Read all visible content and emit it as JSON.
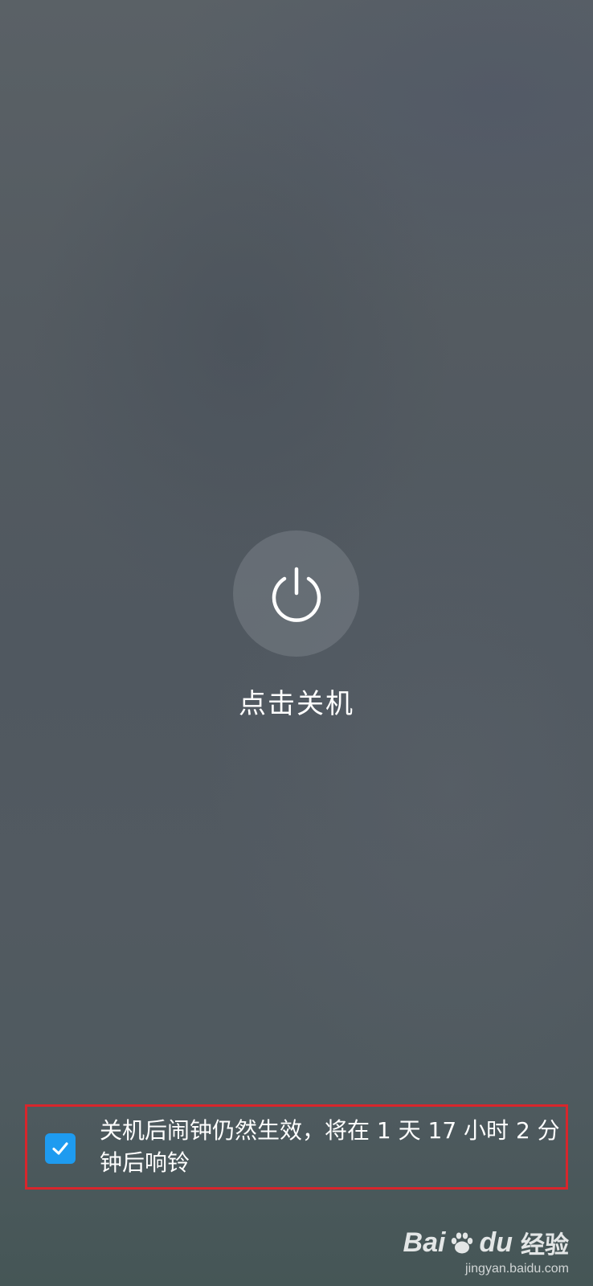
{
  "power": {
    "icon": "power-icon",
    "label": "点击关机"
  },
  "alarm_notice": {
    "checked": true,
    "text": "关机后闹钟仍然生效，将在 1 天 17 小时 2 分钟后响铃",
    "checkbox_color": "#1e9bf0",
    "highlight_color": "#d8262c"
  },
  "watermark": {
    "brand_left": "Bai",
    "brand_right": "du",
    "brand_cn": "经验",
    "url": "jingyan.baidu.com"
  }
}
